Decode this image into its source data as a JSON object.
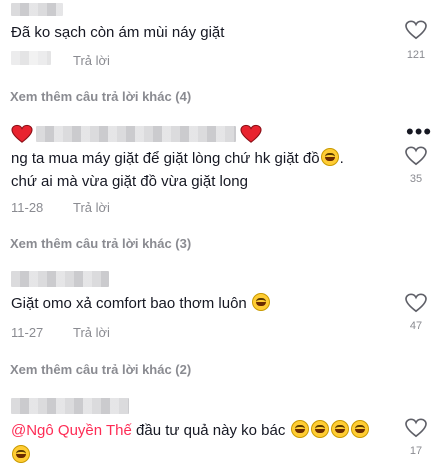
{
  "comments": [
    {
      "text": "Đã ko sạch còn ám mùi náy giặt",
      "reply_label": "Trả lời",
      "likes": "121",
      "more_replies": "Xem thêm câu trả lời khác (4)"
    },
    {
      "text_line1": "ng ta mua máy giặt để giặt lòng chứ hk giặt đồ",
      "text_line1_end": ".",
      "text_line2": "chứ ai mà vừa giặt đồ vừa giặt long",
      "date": "11-28",
      "reply_label": "Trả lời",
      "likes": "35",
      "more_replies": "Xem thêm câu trả lời khác (3)"
    },
    {
      "text": "Giặt omo xả comfort bao thơm luôn",
      "date": "11-27",
      "reply_label": "Trả lời",
      "likes": "47",
      "more_replies": "Xem thêm câu trả lời khác (2)"
    },
    {
      "mention": "@Ngô Quyền Thế",
      "text": " đầu tư quả này ko bác",
      "likes": "17"
    }
  ],
  "icons": {
    "heart": "heart-outline-icon",
    "laugh": "grinning-sweat-emoji",
    "red_heart": "red-heart-emoji",
    "more": "more-options-icon"
  },
  "colors": {
    "mention": "#fe2c55",
    "meta": "#8a8b91"
  }
}
